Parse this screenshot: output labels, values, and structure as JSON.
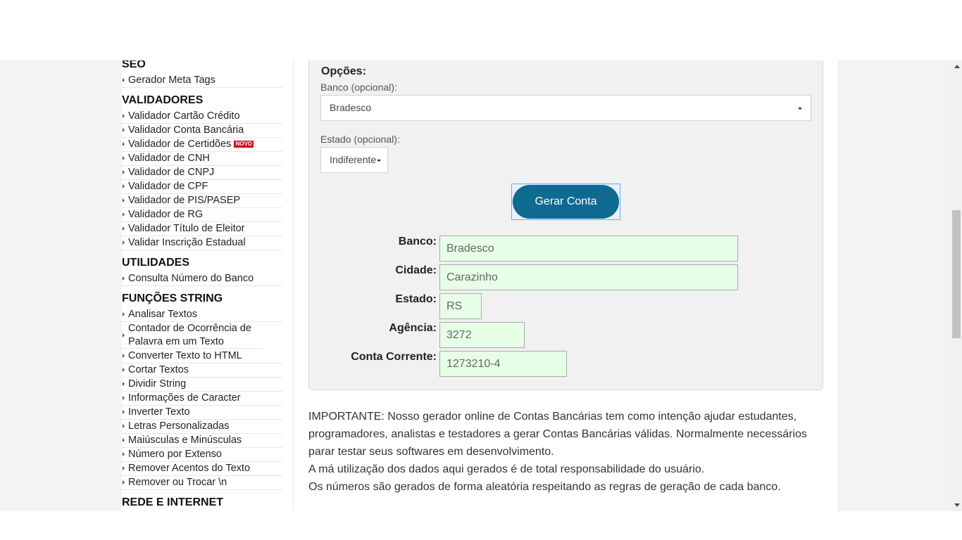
{
  "sidebar": {
    "seo": {
      "title": "SEO",
      "items": [
        "Gerador Meta Tags"
      ]
    },
    "validadores": {
      "title": "VALIDADORES",
      "items": [
        "Validador Cartão Crédito",
        "Validador Conta Bancária",
        "Validador de Certidões",
        "Validador de CNH",
        "Validador de CNPJ",
        "Validador de CPF",
        "Validador de PIS/PASEP",
        "Validador de RG",
        "Validador Título de Eleitor",
        "Validar Inscrição Estadual"
      ],
      "badge": "NOVO"
    },
    "utilidades": {
      "title": "UTILIDADES",
      "items": [
        "Consulta Número do Banco"
      ]
    },
    "funcoes": {
      "title": "FUNÇÕES STRING",
      "items": [
        "Analisar Textos",
        "Contador de Ocorrência de Palavra em um Texto",
        "Converter Texto to HTML",
        "Cortar Textos",
        "Dividir String",
        "Informações de Caracter",
        "Inverter Texto",
        "Letras Personalizadas",
        "Maiúsculas e Minúsculas",
        "Número por Extenso",
        "Remover Acentos do Texto",
        "Remover ou Trocar \\n"
      ]
    },
    "rede": {
      "title": "REDE E INTERNET"
    }
  },
  "form": {
    "options_title": "Opções:",
    "bank_label": "Banco (opcional):",
    "bank_value": "Bradesco",
    "state_label": "Estado (opcional):",
    "state_value": "Indiferente",
    "generate_label": "Gerar Conta"
  },
  "result": {
    "banco_label": "Banco:",
    "banco": "Bradesco",
    "cidade_label": "Cidade:",
    "cidade": "Carazinho",
    "estado_label": "Estado:",
    "estado": "RS",
    "agencia_label": "Agência:",
    "agencia": "3272",
    "conta_label": "Conta Corrente:",
    "conta": "1273210-4"
  },
  "info": {
    "line1": "IMPORTANTE: Nosso gerador online de Contas Bancárias tem como intenção ajudar estudantes, programadores, analistas e testadores a gerar Contas Bancárias válidas. Normalmente necessários parar testar seus softwares em desenvolvimento.",
    "line2": "A má utilização dos dados aqui gerados é de total responsabilidade do usuário.",
    "line3": "Os números são gerados de forma aleatória respeitando as regras de geração de cada banco."
  },
  "colors": {
    "button": "#0e6a90",
    "result_field": "#e6ffe6",
    "badge": "#d0021b"
  }
}
